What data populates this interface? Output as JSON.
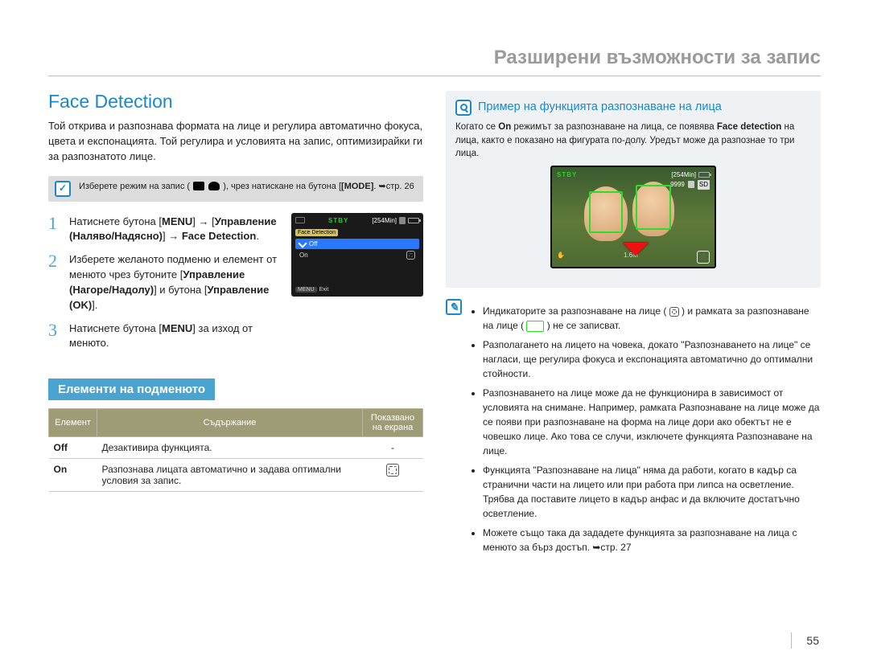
{
  "chapter": "Разширени възможности за запис",
  "page_number": "55",
  "left": {
    "title": "Face Detection",
    "intro": "Той открива и разпознава формата на лице и регулира автоматично фокуса, цвета и експонацията. Той регулира и условията на запис, оптимизирайки ги за разпознатото лице.",
    "mode_prefix": "Изберете режим на запис ( ",
    "mode_suffix": " ), чрез натискане на бутона ",
    "mode_btn": "[MODE]",
    "mode_ref": ". ➥стр. 26",
    "steps": {
      "s1_a": "Натиснете бутона [",
      "s1_menu": "MENU",
      "s1_b": "] → [",
      "s1_ctrl": "Управление (Наляво/Надясно)",
      "s1_c": "] → ",
      "s1_fd": "Face Detection",
      "s1_d": ".",
      "s2_a": "Изберете желаното подменю и елемент от менюто чрез бутоните [",
      "s2_ud": "Управление (Нагоре/Надолу)",
      "s2_b": "] и бутона [",
      "s2_ok": "Управление (OK)",
      "s2_c": "].",
      "s3_a": "Натиснете бутона [",
      "s3_menu": "MENU",
      "s3_b": "] за изход от менюто."
    },
    "lcd": {
      "stby": "STBY",
      "time": "[254Min]",
      "menu_label": "Face Detection",
      "opt_off": "Off",
      "opt_on": "On",
      "foot_btn": "MENU",
      "foot_exit": "Exit"
    },
    "submenu_heading": "Елементи на подменюто",
    "table": {
      "h1": "Елемент",
      "h2": "Съдържание",
      "h3": "Показвано на екрана",
      "r1c1": "Off",
      "r1c2": "Дезактивира функцията.",
      "r1c3": "-",
      "r2c1": "On",
      "r2c2": "Разпознава лицата автоматично и задава оптимални условия за запис."
    }
  },
  "right": {
    "example_title": "Пример на функцията разпознаване на лица",
    "example_p1a": "Когато се ",
    "example_on": "On",
    "example_p1b": " режимът за разпознаване на лица, се появява ",
    "example_fd": "Face detection",
    "example_p1c": " на лица, както е показано на фигурата по-долу. Уредът може да разпознае то три лица.",
    "lcd": {
      "stby": "STBY",
      "time": "[254Min]",
      "count": "9999",
      "sd": "SD",
      "resolution": "1.6M"
    },
    "notes": [
      {
        "pre": "Индикаторите за разпознаване на лице ( ",
        "mid": " ) и рамката за разпознаване на лице ( ",
        "post": " ) не се записват."
      },
      {
        "full": "Разполагането на лицето на човека, докато \"Разпознаването на лице\" се нагласи, ще регулира фокуса и експонацията автоматично до оптимални стойности."
      },
      {
        "full": "Разпознаването на лице може да не функционира в зависимост от условията на снимане. Например, рамката Разпознаване на лице може да се появи при разпознаване на форма на лице дори ако обектът не е човешко лице. Ако това се случи, изключете функцията Разпознаване на лице."
      },
      {
        "full": "Функцията \"Разпознаване на лица\" няма да работи, когато в кадър са странични части на лицето или при работа при липса на осветление. Трябва да поставите лицето в кадър анфас и да включите достатъчно осветление."
      },
      {
        "full": "Можете също така да зададете функцията за разпознаване на лица с менюто за бърз достъп. ➥стр. 27"
      }
    ]
  }
}
